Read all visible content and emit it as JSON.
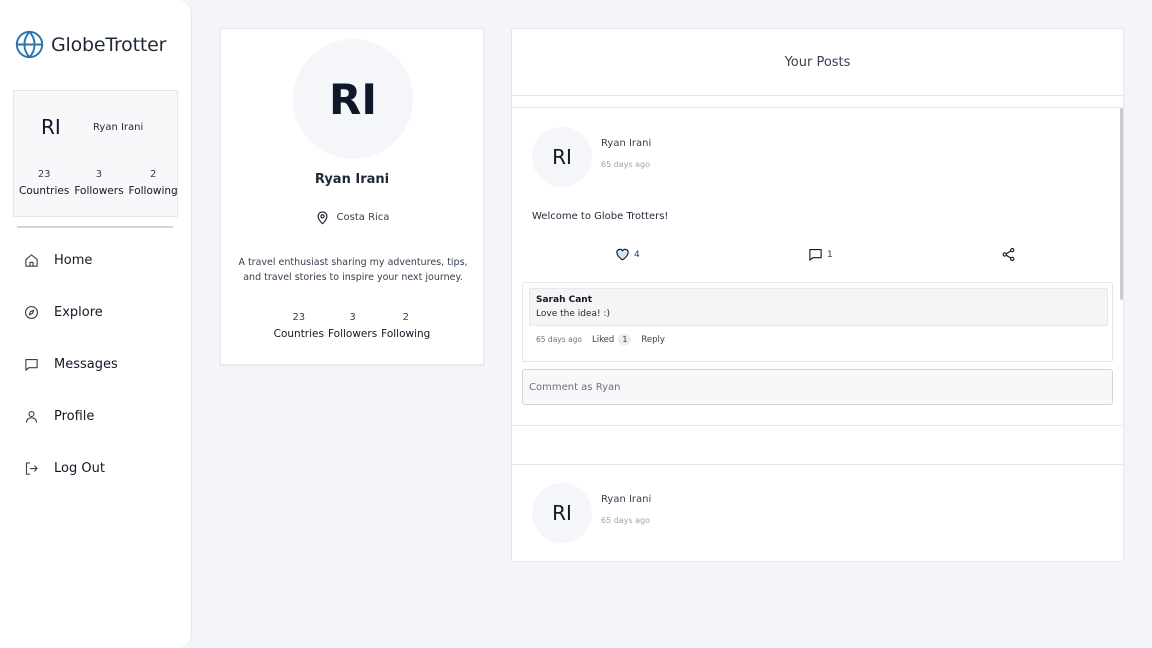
{
  "app": {
    "name": "GlobeTrotter"
  },
  "colors": {
    "accent": "#2b74a8",
    "background": "#f4f5fb"
  },
  "sidebar": {
    "profile": {
      "initials": "RI",
      "name": "Ryan Irani",
      "stats": [
        {
          "value": "23",
          "label": "Countries"
        },
        {
          "value": "3",
          "label": "Followers"
        },
        {
          "value": "2",
          "label": "Following"
        }
      ]
    },
    "nav": [
      {
        "label": "Home",
        "icon": "home-icon"
      },
      {
        "label": "Explore",
        "icon": "compass-icon"
      },
      {
        "label": "Messages",
        "icon": "message-icon"
      },
      {
        "label": "Profile",
        "icon": "user-icon"
      },
      {
        "label": "Log Out",
        "icon": "logout-icon"
      }
    ]
  },
  "profile": {
    "initials": "RI",
    "name": "Ryan Irani",
    "location": "Costa Rica",
    "bio": "A travel enthusiast sharing my adventures, tips, and travel stories to inspire your next journey.",
    "stats": [
      {
        "value": "23",
        "label": "Countries"
      },
      {
        "value": "3",
        "label": "Followers"
      },
      {
        "value": "2",
        "label": "Following"
      }
    ]
  },
  "posts_panel": {
    "title": "Your Posts",
    "posts": [
      {
        "initials": "RI",
        "author": "Ryan Irani",
        "time": "65 days ago",
        "text": "Welcome to Globe Trotters!",
        "likes": "4",
        "comments": "1",
        "comment": {
          "author": "Sarah Cant",
          "text": "Love the idea! :)",
          "time": "65 days ago",
          "liked_label": "Liked",
          "liked_count": "1",
          "reply_label": "Reply"
        },
        "comment_placeholder": "Comment as Ryan"
      },
      {
        "initials": "RI",
        "author": "Ryan Irani",
        "time": "65 days ago"
      }
    ]
  }
}
